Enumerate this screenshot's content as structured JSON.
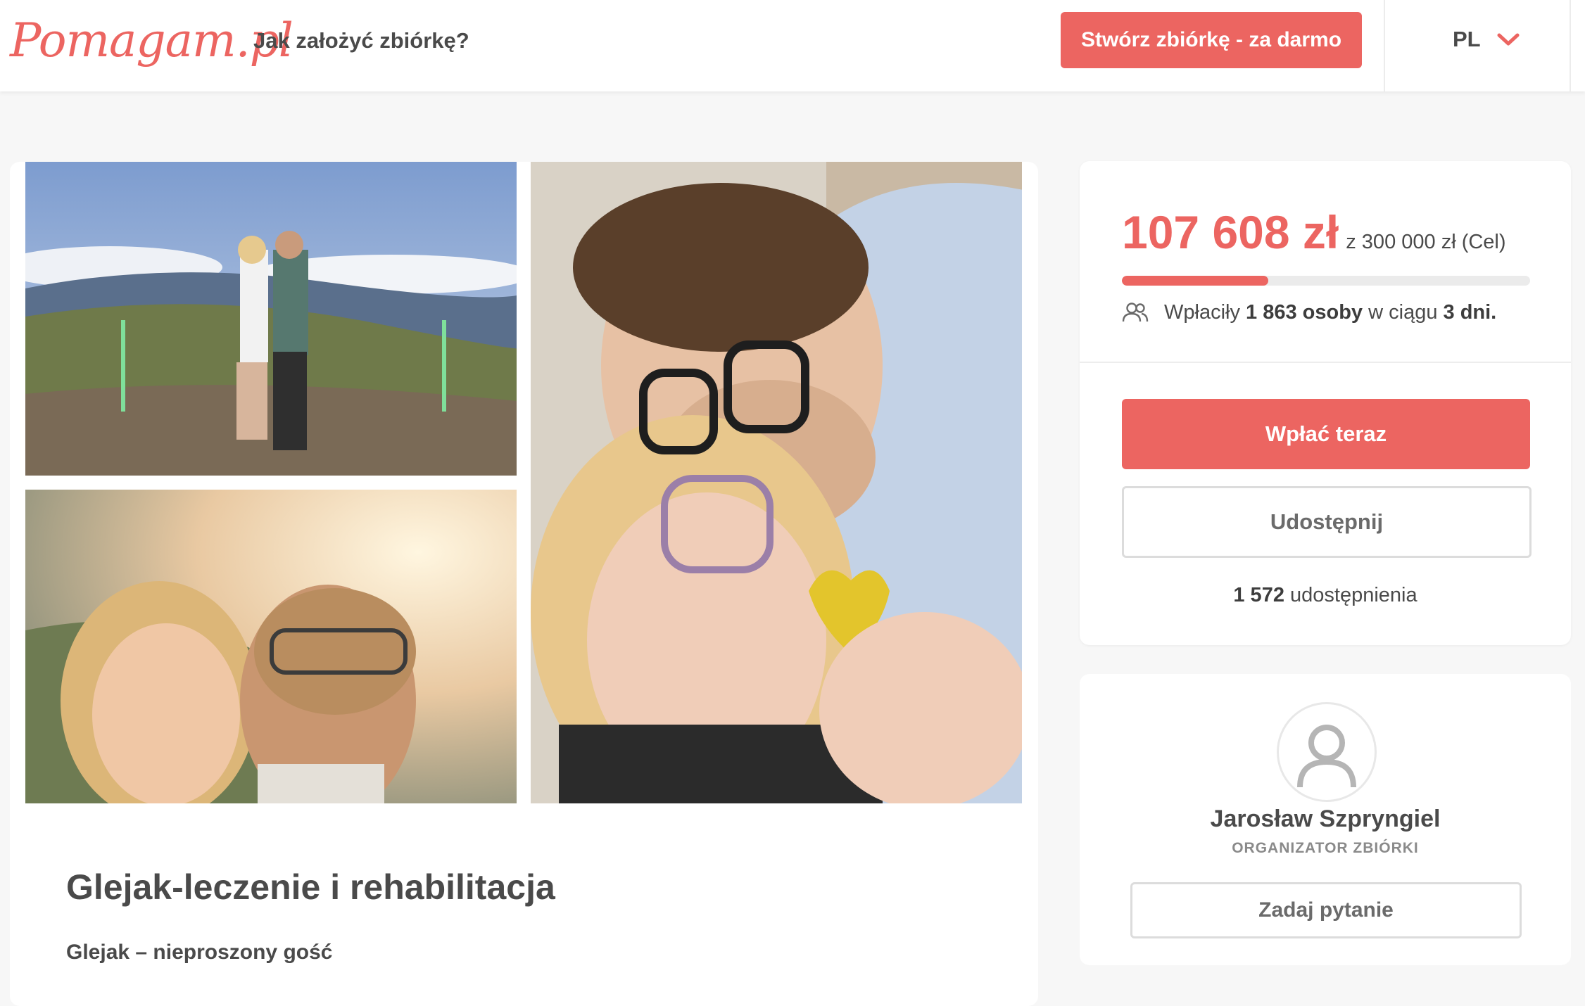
{
  "header": {
    "logo": "Pomagam.pl",
    "nav_link": "Jak założyć zbiórkę?",
    "create_button": "Stwórz zbiórkę - za darmo",
    "language": "PL"
  },
  "campaign": {
    "title": "Glejak-leczenie i rehabilitacja",
    "subtitle": "Glejak – nieproszony gość",
    "photos": [
      "couple-mountain-photo",
      "couple-sunset-selfie-photo",
      "couple-heart-selfie-photo"
    ]
  },
  "donation": {
    "raised": "107 608 zł",
    "goal": "z 300 000 zł (Cel)",
    "progress_fraction": 0.3587,
    "donors_prefix": "Wpłaciły",
    "donors_count": "1 863 osoby",
    "donors_middle": "w ciągu",
    "days": "3 dni.",
    "pay_button": "Wpłać teraz",
    "share_button": "Udostępnij",
    "shares_count": "1 572",
    "shares_label": "udostępnienia"
  },
  "organizer": {
    "name": "Jarosław Szpryngiel",
    "role": "ORGANIZATOR ZBIÓRKI",
    "ask_button": "Zadaj pytanie"
  },
  "colors": {
    "accent": "#ec6561",
    "background": "#f7f7f7"
  }
}
